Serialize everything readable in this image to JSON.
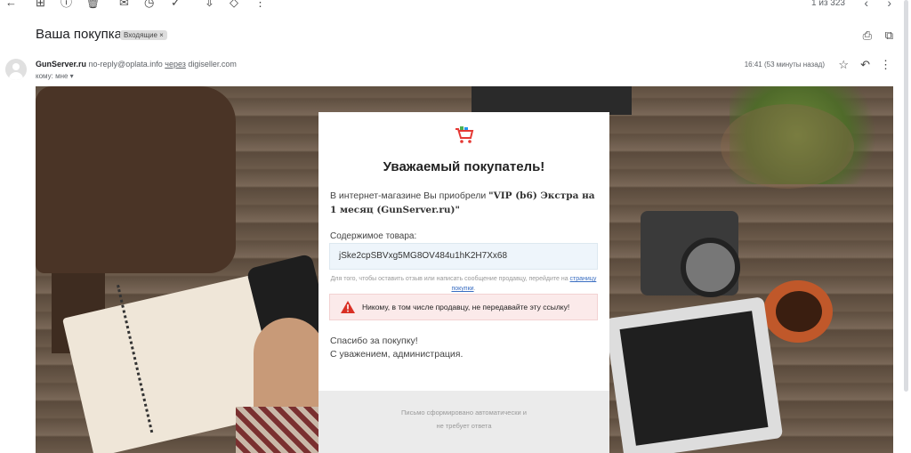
{
  "toolbar": {
    "back_icon": "←",
    "archive_icon": "⊞",
    "report_icon": "ⓘ",
    "delete_icon": "🗑",
    "mail_icon": "✉",
    "snooze_icon": "◷",
    "task_icon": "✓",
    "move_icon": "⇩",
    "label_icon": "◇",
    "more_icon": "⋮",
    "pager": "1 из 323",
    "prev_icon": "‹",
    "next_icon": "›"
  },
  "email": {
    "subject": "Ваша покупка",
    "label": "Входящие ×",
    "sender_name": "GunServer.ru",
    "sender_email": "no-reply@oplata.info",
    "via": "через",
    "via_domain": "digiseller.com",
    "to_me": "кому: мне ▾",
    "time": "16:41 (53 минуты назад)",
    "star_icon": "☆",
    "reply_icon": "↶",
    "more_icon": "⋮",
    "print_icon": "⎙",
    "newwindow_icon": "⧉"
  },
  "card": {
    "title": "Уважаемый покупатель!",
    "intro_prefix": "В интернет-магазине Вы приобрели ",
    "product": "\"VIP (b6) Экстра на 1 месяц (GunServer.ru)\"",
    "content_label": "Содержимое товара:",
    "code": "jSke2cpSBVxg5MG8OV484u1hK2H7Xx68",
    "hint_prefix": "Для того, чтобы оставить отзыв или написать сообщение продавцу, перейдите на",
    "hint_link": "страницу покупки",
    "hint_suffix": ".",
    "warning": "Никому, в том числе продавцу, не передавайте эту ссылку!",
    "thanks_1": "Спасибо за покупку!",
    "thanks_2": "С уважением, администрация.",
    "footer_1": "Письмо сформировано автоматически и",
    "footer_2": "не требует ответа"
  },
  "colors": {
    "link": "#3a6ec2",
    "warning_bg": "#fbeaea",
    "warning_icon": "#d93025",
    "code_bg": "#eef5fb"
  }
}
